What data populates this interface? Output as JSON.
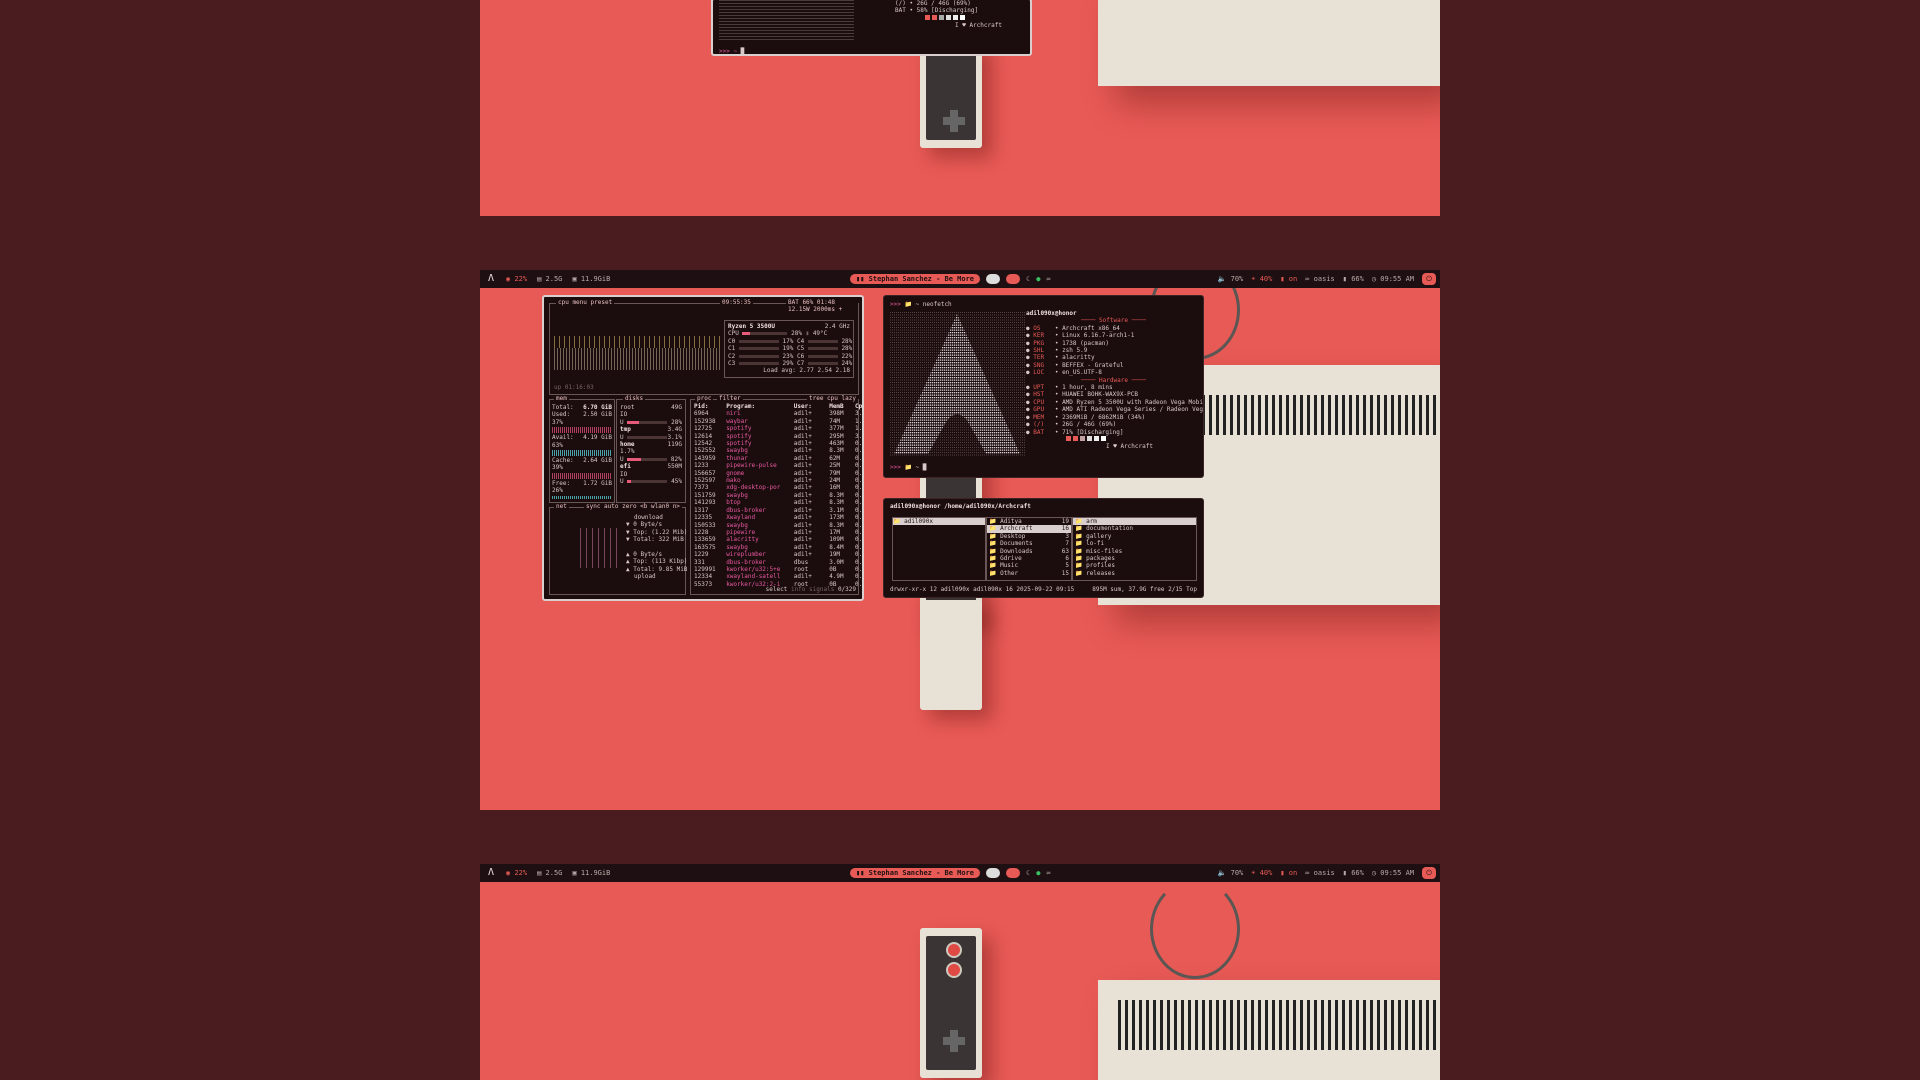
{
  "bar": {
    "cpu": "22%",
    "temp": "2.5G",
    "mem": "11.9GiB",
    "now_playing": "Stephan Sanchez - Be More",
    "volume": "70%",
    "brightness": "40%",
    "mic": "on",
    "wifi": "oasis",
    "battery": "66%",
    "clock": "09:55 AM"
  },
  "btop": {
    "header_left": "cpu  menu  preset",
    "header_clock": "09:55:35",
    "header_right": "BAT 66% 01:48 12.15W  2000ms +",
    "cpu_name": "Ryzen 5 3500U",
    "cpu_freq": "2.4 GHz",
    "uptime": "up 01:16:03",
    "cores": [
      {
        "label": "CPU",
        "pct": "28%",
        "temp": "49°C"
      },
      {
        "label": "C0",
        "pct": "17%",
        "c2": "C4",
        "p2": "28%"
      },
      {
        "label": "C1",
        "pct": "19%",
        "c2": "C5",
        "p2": "28%"
      },
      {
        "label": "C2",
        "pct": "23%",
        "c2": "C6",
        "p2": "22%"
      },
      {
        "label": "C3",
        "pct": "29%",
        "c2": "C7",
        "p2": "24%"
      }
    ],
    "load_avg": "Load avg: 2.77 2.54 2.18",
    "mem": {
      "title": "mem",
      "total": "6.70 GiB",
      "used": "2.50 GiB",
      "used_pct": "37%",
      "avail": "4.19 GiB",
      "avail_pct": "63%",
      "cache": "2.64 GiB",
      "cache_pct": "39%",
      "free": "1.72 GiB",
      "free_pct": "26%"
    },
    "disks": {
      "title": "disks",
      "items": [
        {
          "name": "root",
          "size": "49G",
          "io": "IO",
          "pct": "28%"
        },
        {
          "name": "tmp",
          "size": "3.4G",
          "io": "U",
          "pct": "3.1%"
        },
        {
          "name": "home",
          "size": "119G",
          "io": "1.7%",
          "pct": ""
        },
        {
          "name": "efi",
          "size": "550M",
          "io": "IO",
          "pct": "45%"
        }
      ]
    },
    "net": {
      "title": "net",
      "tabs": "sync  auto  zero  <b wlan0 n>",
      "download": "download",
      "dl_rate": "0 Byte/s",
      "dl_top": "Top: (1.22 Mib)",
      "dl_total": "Total: 322 MiB",
      "ul_rate": "0 Byte/s",
      "ul_top": "Top: (113 Kibp)",
      "ul_total": "Total: 9.85 MiB",
      "upload": "upload"
    },
    "proc": {
      "title": "proc",
      "filter": "filter",
      "mode": "tree  cpu lazy",
      "columns": [
        "Pid:",
        "Program:",
        "User:",
        "MemB",
        "Cpu%"
      ],
      "rows": [
        [
          "6964",
          "niri",
          "adil+",
          "398M",
          "3.2"
        ],
        [
          "152938",
          "waybar",
          "adil+",
          "74M",
          "1.3"
        ],
        [
          "12725",
          "spotify",
          "adil+",
          "377M",
          "1.3"
        ],
        [
          "12614",
          "spotify",
          "adil+",
          "295M",
          "3.4"
        ],
        [
          "12542",
          "spotify",
          "adil+",
          "463M",
          "0.5"
        ],
        [
          "152552",
          "swaybg",
          "adil+",
          "8.3M",
          "0.0"
        ],
        [
          "143959",
          "thunar",
          "adil+",
          "62M",
          "0.0"
        ],
        [
          "1233",
          "pipewire-pulse",
          "adil+",
          "25M",
          "0.2"
        ],
        [
          "156657",
          "gnome",
          "adil+",
          "79M",
          "0.0"
        ],
        [
          "152597",
          "mako",
          "adil+",
          "24M",
          "0.1"
        ],
        [
          "7373",
          "xdg-desktop-por",
          "adil+",
          "16M",
          "0.0"
        ],
        [
          "151759",
          "swaybg",
          "adil+",
          "8.3M",
          "0.0"
        ],
        [
          "141293",
          "btop",
          "adil+",
          "8.3M",
          "0.1"
        ],
        [
          "1317",
          "dbus-broker",
          "adil+",
          "3.1M",
          "0.1"
        ],
        [
          "12335",
          "Xwayland",
          "adil+",
          "173M",
          "0.1"
        ],
        [
          "150533",
          "swaybg",
          "adil+",
          "8.3M",
          "0.0"
        ],
        [
          "1228",
          "pipewire",
          "adil+",
          "17M",
          "0.0"
        ],
        [
          "133659",
          "alacritty",
          "adil+",
          "109M",
          "0.0"
        ],
        [
          "163575",
          "swaybg",
          "adil+",
          "8.4M",
          "0.0"
        ],
        [
          "1229",
          "wireplumber",
          "adil+",
          "19M",
          "0.4"
        ],
        [
          "331",
          "dbus-broker",
          "dbus",
          "3.0M",
          "0.0"
        ],
        [
          "129991",
          "kworker/u32:5+e",
          "root",
          "0B",
          "0.1"
        ],
        [
          "12334",
          "xwayland-satell",
          "adil+",
          "4.9M",
          "0.1"
        ],
        [
          "55373",
          "kworker/u32:2-i",
          "root",
          "0B",
          "0.0"
        ]
      ],
      "footer_select": "select",
      "footer_info": "info",
      "footer_signals": "signals",
      "footer_count": "0/329"
    }
  },
  "neofetch": {
    "prompt": ">>> ",
    "command": "~ neofetch",
    "user_host": "adil090x@honor",
    "software_header": "Software",
    "hardware_header": "Hardware",
    "software": [
      {
        "k": "OS",
        "v": "Archcraft x86_64"
      },
      {
        "k": "KER",
        "v": "Linux 6.16.7-arch1-1"
      },
      {
        "k": "PKG",
        "v": "1738 (pacman)"
      },
      {
        "k": "SHL",
        "v": "zsh 5.9"
      },
      {
        "k": "TER",
        "v": "alacritty"
      },
      {
        "k": "SNG",
        "v": "BEFFEX - Grateful"
      },
      {
        "k": "LOC",
        "v": "en_US.UTF-8"
      }
    ],
    "hardware": [
      {
        "k": "UPT",
        "v": "1 hour, 8 mins"
      },
      {
        "k": "HST",
        "v": "HUAWEI BOHK-WAX9X-PCB"
      },
      {
        "k": "CPU",
        "v": "AMD Ryzen 5 3500U with Radeon Vega Mobile"
      },
      {
        "k": "GPU",
        "v": "AMD ATI Radeon Vega Series / Radeon Vega"
      },
      {
        "k": "MEM",
        "v": "2369MiB / 6862MiB (34%)"
      },
      {
        "k": "(/)",
        "v": "26G / 46G (69%)"
      },
      {
        "k": "BAT",
        "v": "71% [Discharging]"
      }
    ],
    "footer": "I ♥ Archcraft",
    "prompt2": ">>> ~"
  },
  "neofetch_top": {
    "line1": "(/) • 26G / 46G (69%)",
    "line2": "BAT • 58% [Discharging]",
    "footer": "I ♥ Archcraft",
    "prompt": ">>> ~"
  },
  "ranger": {
    "path": "adil090x@honor /home/adil090x/Archcraft",
    "col1": [
      {
        "name": "adil090x",
        "count": ""
      }
    ],
    "col2": [
      {
        "name": "Aditya",
        "count": "19"
      },
      {
        "name": "Archcraft",
        "count": "16"
      },
      {
        "name": "Desktop",
        "count": "3"
      },
      {
        "name": "Documents",
        "count": "7"
      },
      {
        "name": "Downloads",
        "count": "63"
      },
      {
        "name": "Gdrive",
        "count": "6"
      },
      {
        "name": "Music",
        "count": "5"
      },
      {
        "name": "Other",
        "count": "15"
      }
    ],
    "col3": [
      "arm",
      "documentation",
      "gallery",
      "lo-fi",
      "misc-files",
      "packages",
      "profiles",
      "releases"
    ],
    "status_left": "drwxr-xr-x 12 adil090x adil090x 16 2025-09-22 09:15",
    "status_right": "895M sum, 37.9G free  2/15  Top"
  },
  "colors": {
    "accent": "#e85a55",
    "bg": "#1b0c0e",
    "outer": "#4a1c20"
  }
}
